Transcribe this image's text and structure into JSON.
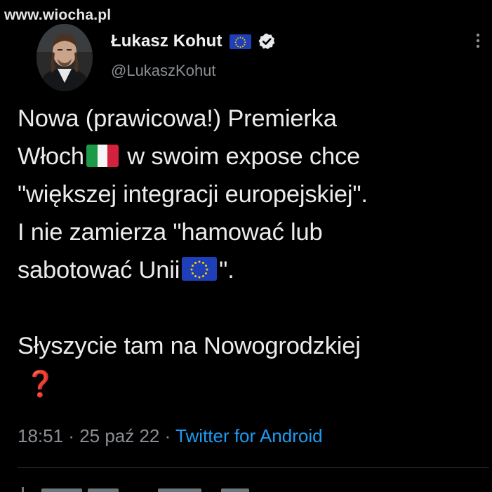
{
  "watermark": "www.wiocha.pl",
  "author": {
    "display_name": "Łukasz Kohut",
    "handle": "@LukaszKohut",
    "name_badges": [
      "eu-flag-icon",
      "verified-badge-icon"
    ]
  },
  "tweet": {
    "lines": [
      "Nowa (prawicowa!) Premierka",
      "Włoch",
      " w swoim expose chce",
      "\"większej integracji europejskiej\".",
      "I nie zamierza \"hamować lub",
      "sabotować Unii",
      "\".",
      "Słyszycie tam na Nowogrodzkiej"
    ],
    "inline_icons": [
      "italy-flag-icon",
      "eu-flag-icon",
      "red-question-mark-icon"
    ]
  },
  "meta": {
    "time": "18:51",
    "separator": " · ",
    "date": "25 paź 22",
    "source": "Twitter for Android"
  },
  "colors": {
    "background": "#000000",
    "text": "#e7e9ea",
    "secondary": "#8b8f94",
    "link": "#1d9bf0",
    "question_mark": "#e1242f",
    "eu_blue": "#1f3fb8",
    "eu_star": "#f6d200"
  }
}
